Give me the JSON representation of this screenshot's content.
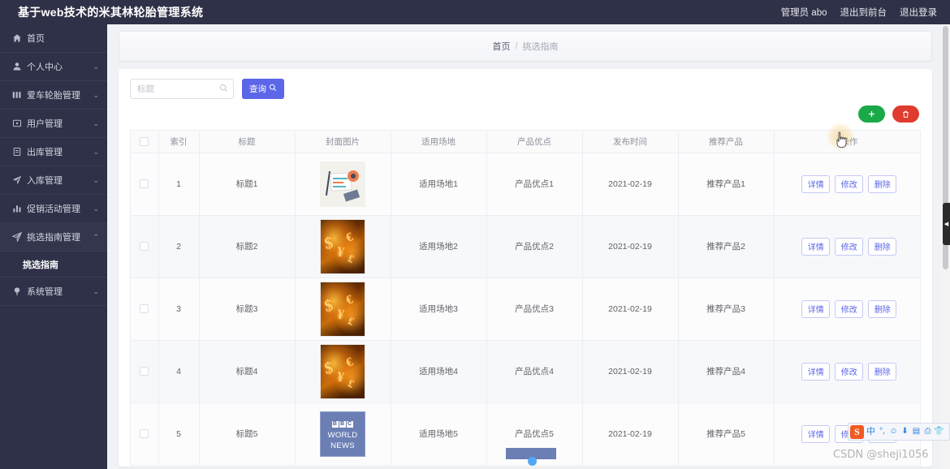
{
  "header": {
    "title": "基于web技术的米其林轮胎管理系统",
    "user_label": "管理员 abo",
    "logout_front": "退出到前台",
    "logout": "退出登录"
  },
  "sidebar": {
    "items": [
      {
        "label": "首页",
        "icon": "home-icon",
        "caret": "",
        "expanded": false
      },
      {
        "label": "个人中心",
        "icon": "user-icon",
        "caret": "⌄",
        "expanded": false
      },
      {
        "label": "爱车轮胎管理",
        "icon": "tire-icon",
        "caret": "⌄",
        "expanded": false
      },
      {
        "label": "用户管理",
        "icon": "users-icon",
        "caret": "⌄",
        "expanded": false
      },
      {
        "label": "出库管理",
        "icon": "box-out-icon",
        "caret": "⌄",
        "expanded": false
      },
      {
        "label": "入库管理",
        "icon": "box-in-icon",
        "caret": "⌄",
        "expanded": false
      },
      {
        "label": "促销活动管理",
        "icon": "chart-icon",
        "caret": "⌄",
        "expanded": false
      },
      {
        "label": "挑选指南管理",
        "icon": "guide-icon",
        "caret": "⌃",
        "expanded": true
      },
      {
        "label": "系统管理",
        "icon": "settings-icon",
        "caret": "⌄",
        "expanded": false
      }
    ],
    "submenu": {
      "parent_index": 7,
      "label": "挑选指南"
    }
  },
  "breadcrumb": {
    "home": "首页",
    "separator": "/",
    "current": "挑选指南"
  },
  "toolbar": {
    "search_placeholder": "标题",
    "search_value": "",
    "query_label": "查询",
    "add_label": "+",
    "delete_label": "🗑"
  },
  "table": {
    "columns": [
      "索引",
      "标题",
      "封面图片",
      "适用场地",
      "产品优点",
      "发布时间",
      "推荐产品",
      "操作"
    ],
    "row_actions": [
      "详情",
      "修改",
      "删除"
    ],
    "rows": [
      {
        "index": "1",
        "title": "标题1",
        "image": "news-illustration",
        "venue": "适用场地1",
        "merit": "产品优点1",
        "date": "2021-02-19",
        "product": "推荐产品1"
      },
      {
        "index": "2",
        "title": "标题2",
        "image": "money-abstract",
        "venue": "适用场地2",
        "merit": "产品优点2",
        "date": "2021-02-19",
        "product": "推荐产品2"
      },
      {
        "index": "3",
        "title": "标题3",
        "image": "money-abstract",
        "venue": "适用场地3",
        "merit": "产品优点3",
        "date": "2021-02-19",
        "product": "推荐产品3"
      },
      {
        "index": "4",
        "title": "标题4",
        "image": "money-abstract",
        "venue": "适用场地4",
        "merit": "产品优点4",
        "date": "2021-02-19",
        "product": "推荐产品4"
      },
      {
        "index": "5",
        "title": "标题5",
        "image": "bbc-world-news",
        "venue": "适用场地5",
        "merit": "产品优点5",
        "date": "2021-02-19",
        "product": "推荐产品5"
      }
    ]
  },
  "thumbnail_bbc": {
    "logo": "BBC",
    "line1": "WORLD",
    "line2": "NEWS"
  },
  "ime": {
    "logo": "S",
    "mode": "中",
    "icons": [
      "punctuation-icon",
      "emoji-icon",
      "microphone-icon",
      "keyboard-icon",
      "clipboard-icon",
      "skin-icon",
      "menu-icon"
    ]
  },
  "watermark": "CSDN @sheji1056",
  "colors": {
    "sidebar_bg": "#2e3147",
    "primary": "#5b66e8",
    "add_green": "#1aa948",
    "delete_red": "#e03b2f",
    "page_bg": "#f1f2f5"
  }
}
